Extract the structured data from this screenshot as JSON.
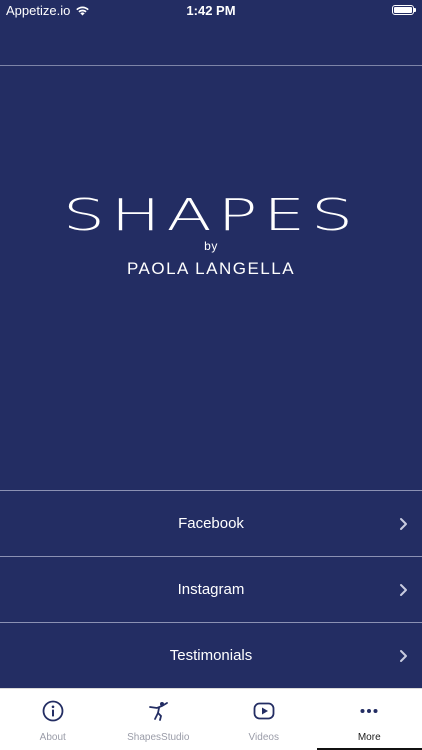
{
  "status_bar": {
    "carrier": "Appetize.io",
    "time": "1:42 PM",
    "battery_level": 1.0
  },
  "logo": {
    "title": "SHAPES",
    "by": "by",
    "subtitle": "PAOLA LANGELLA"
  },
  "menu": {
    "items": [
      {
        "label": "Facebook"
      },
      {
        "label": "Instagram"
      },
      {
        "label": "Testimonials"
      }
    ]
  },
  "tab_bar": {
    "tabs": [
      {
        "label": "About",
        "icon": "info-icon"
      },
      {
        "label": "ShapesStudio",
        "icon": "figure-icon"
      },
      {
        "label": "Videos",
        "icon": "play-icon"
      },
      {
        "label": "More",
        "icon": "more-icon"
      }
    ],
    "active": "More"
  },
  "colors": {
    "background": "#232d63",
    "tab_bar": "#ffffff",
    "inactive_tab": "#9a9ca8"
  }
}
